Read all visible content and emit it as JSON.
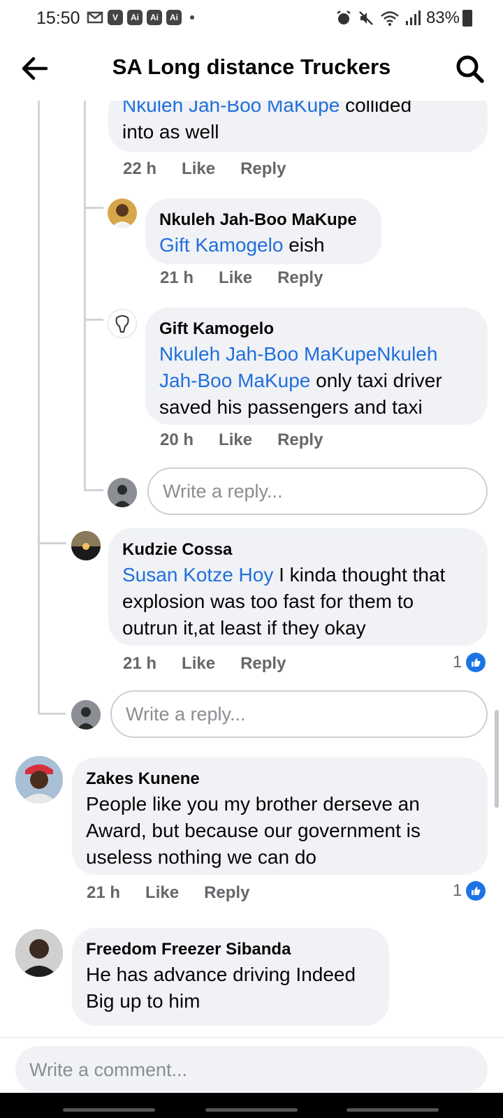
{
  "status_bar": {
    "time": "15:50",
    "left_icons": [
      "gmail-icon",
      "v-app-icon",
      "ai-app-icon",
      "ai-app-icon",
      "ai-app-icon"
    ],
    "ai_label": "Ai",
    "v_label": "V",
    "battery": "83%"
  },
  "header": {
    "title": "SA Long distance Truckers"
  },
  "thread": {
    "top_partial": {
      "mention": "Nkuleh Jah-Boo MaKupe",
      "text_line1_rest": " collided",
      "text_line2": "into as well",
      "time": "22 h",
      "like": "Like",
      "reply": "Reply"
    },
    "reply_nkuleh": {
      "author": "Nkuleh Jah-Boo MaKupe",
      "mention": "Gift Kamogelo",
      "text": " eish",
      "time": "21 h",
      "like": "Like",
      "reply": "Reply"
    },
    "reply_gift": {
      "author": "Gift Kamogelo",
      "mention1": "Nkuleh Jah-Boo MaKupeNkuleh",
      "mention2": "Jah-Boo MaKupe",
      "text_line2_rest": " only taxi driver",
      "text_line3": "saved his passengers and taxi",
      "time": "20 h",
      "like": "Like",
      "reply": "Reply"
    },
    "write_reply_1": "Write a reply...",
    "reply_kudzie": {
      "author": "Kudzie Cossa",
      "mention": "Susan Kotze Hoy",
      "text_line1_rest": " I kinda thought that",
      "text_line2": "explosion was too fast for them to",
      "text_line3": "outrun it,at least if they okay",
      "time": "21 h",
      "like": "Like",
      "reply": "Reply",
      "reactions": "1"
    },
    "write_reply_2": "Write a reply...",
    "comment_zakes": {
      "author": "Zakes Kunene",
      "line1": "People like you my brother derseve an",
      "line2": "Award, but because our government is",
      "line3": "useless nothing we can do",
      "time": "21 h",
      "like": "Like",
      "reply": "Reply",
      "reactions": "1"
    },
    "comment_freedom": {
      "author": "Freedom Freezer Sibanda",
      "line1": "He has advance driving Indeed",
      "line2": "Big up to him"
    }
  },
  "composer": {
    "placeholder": "Write a comment..."
  },
  "colors": {
    "mention": "#216fdb",
    "bubble": "#f0f2f5",
    "meta_text": "#65676b",
    "like_badge": "#1b74e4"
  }
}
